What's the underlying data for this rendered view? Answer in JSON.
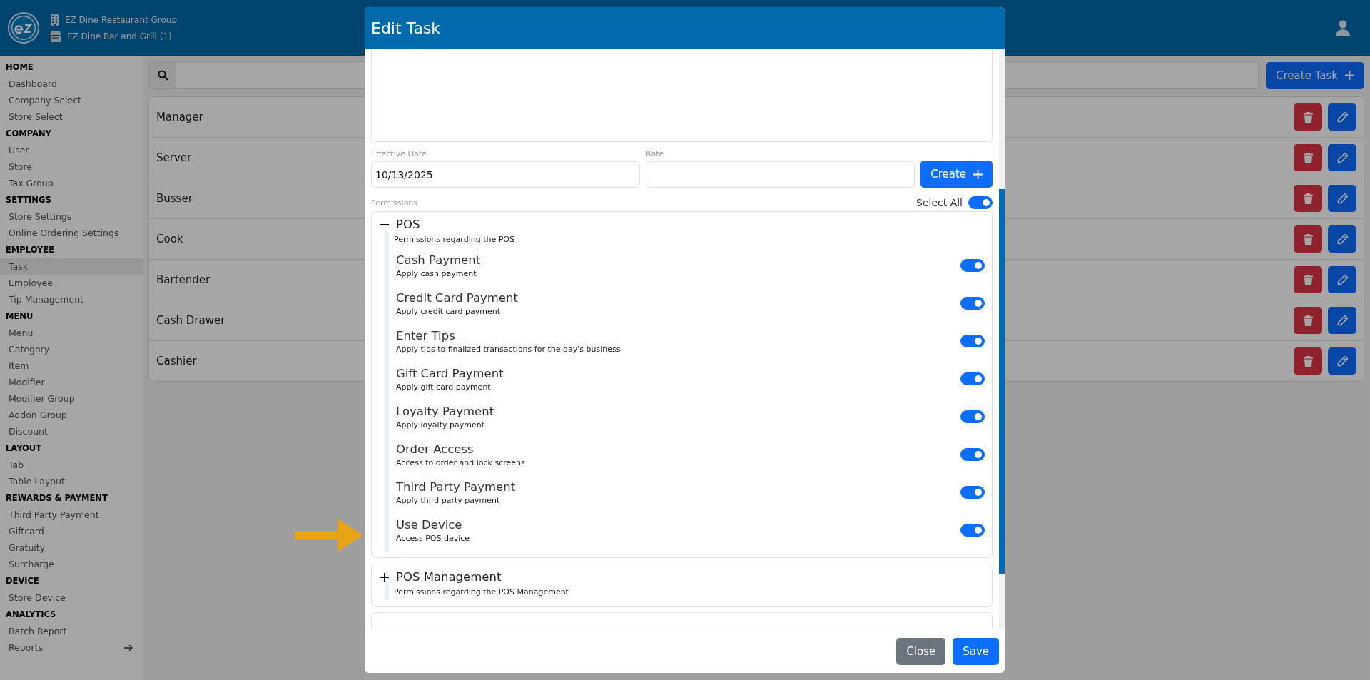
{
  "header": {
    "company": "EZ Dine Restaurant Group",
    "store": "EZ Dine Bar and Grill (1)"
  },
  "sidebar": [
    {
      "heading": "HOME",
      "items": [
        {
          "label": "Dashboard",
          "selected": false,
          "submenu": false
        },
        {
          "label": "Company Select",
          "selected": false,
          "submenu": false
        },
        {
          "label": "Store Select",
          "selected": false,
          "submenu": false
        }
      ]
    },
    {
      "heading": "COMPANY",
      "items": [
        {
          "label": "User",
          "selected": false,
          "submenu": false
        },
        {
          "label": "Store",
          "selected": false,
          "submenu": false
        },
        {
          "label": "Tax Group",
          "selected": false,
          "submenu": false
        }
      ]
    },
    {
      "heading": "SETTINGS",
      "items": [
        {
          "label": "Store Settings",
          "selected": false,
          "submenu": false
        },
        {
          "label": "Online Ordering Settings",
          "selected": false,
          "submenu": false
        }
      ]
    },
    {
      "heading": "EMPLOYEE",
      "items": [
        {
          "label": "Task",
          "selected": true,
          "submenu": false
        },
        {
          "label": "Employee",
          "selected": false,
          "submenu": false
        },
        {
          "label": "Tip Management",
          "selected": false,
          "submenu": false
        }
      ]
    },
    {
      "heading": "MENU",
      "items": [
        {
          "label": "Menu",
          "selected": false,
          "submenu": false
        },
        {
          "label": "Category",
          "selected": false,
          "submenu": false
        },
        {
          "label": "Item",
          "selected": false,
          "submenu": false
        },
        {
          "label": "Modifier",
          "selected": false,
          "submenu": false
        },
        {
          "label": "Modifier Group",
          "selected": false,
          "submenu": false
        },
        {
          "label": "Addon Group",
          "selected": false,
          "submenu": false
        },
        {
          "label": "Discount",
          "selected": false,
          "submenu": false
        }
      ]
    },
    {
      "heading": "LAYOUT",
      "items": [
        {
          "label": "Tab",
          "selected": false,
          "submenu": false
        },
        {
          "label": "Table Layout",
          "selected": false,
          "submenu": false
        }
      ]
    },
    {
      "heading": "REWARDS & PAYMENT",
      "items": [
        {
          "label": "Third Party Payment",
          "selected": false,
          "submenu": false
        },
        {
          "label": "Giftcard",
          "selected": false,
          "submenu": false
        },
        {
          "label": "Gratuity",
          "selected": false,
          "submenu": false
        },
        {
          "label": "Surcharge",
          "selected": false,
          "submenu": false
        }
      ]
    },
    {
      "heading": "DEVICE",
      "items": [
        {
          "label": "Store Device",
          "selected": false,
          "submenu": false
        }
      ]
    },
    {
      "heading": "ANALYTICS",
      "items": [
        {
          "label": "Batch Report",
          "selected": false,
          "submenu": false
        },
        {
          "label": "Reports",
          "selected": false,
          "submenu": true
        }
      ]
    }
  ],
  "create_task_button": "Create Task",
  "tasks": [
    {
      "name": "Manager"
    },
    {
      "name": "Server"
    },
    {
      "name": "Busser"
    },
    {
      "name": "Cook"
    },
    {
      "name": "Bartender"
    },
    {
      "name": "Cash Drawer"
    },
    {
      "name": "Cashier"
    }
  ],
  "modal": {
    "title": "Edit Task",
    "effective_date_label": "Effective Date",
    "effective_date": "10/13/2025",
    "rate_label": "Rate",
    "create_button": "Create",
    "permissions_label": "Permissions",
    "select_all": {
      "label": "Select All",
      "on": true
    },
    "groups": [
      {
        "title": "POS",
        "description": "Permissions regarding the POS",
        "expanded": true,
        "permissions": [
          {
            "title": "Cash Payment",
            "description": "Apply cash payment",
            "on": true
          },
          {
            "title": "Credit Card Payment",
            "description": "Apply credit card payment",
            "on": true
          },
          {
            "title": "Enter Tips",
            "description": "Apply tips to finalized transactions for the day's business",
            "on": true
          },
          {
            "title": "Gift Card Payment",
            "description": "Apply gift card payment",
            "on": true
          },
          {
            "title": "Loyalty Payment",
            "description": "Apply loyalty payment",
            "on": true
          },
          {
            "title": "Order Access",
            "description": "Access to order and lock screens",
            "on": true
          },
          {
            "title": "Third Party Payment",
            "description": "Apply third party payment",
            "on": true
          },
          {
            "title": "Use Device",
            "description": "Access POS device",
            "on": true
          }
        ]
      },
      {
        "title": "POS Management",
        "description": "Permissions regarding the POS Management",
        "expanded": false
      }
    ],
    "close_button": "Close",
    "save_button": "Save"
  }
}
